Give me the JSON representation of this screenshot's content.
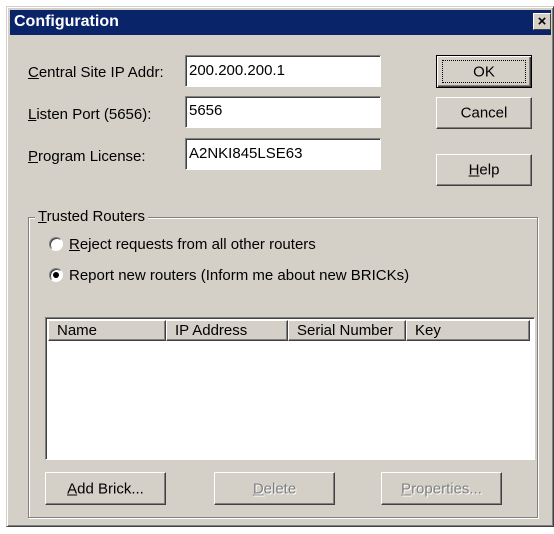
{
  "window": {
    "title": "Configuration",
    "close_glyph": "×"
  },
  "form": {
    "central_ip": {
      "label_accel": "C",
      "label_rest": "entral Site IP Addr:",
      "value": "200.200.200.1"
    },
    "listen_port": {
      "label_accel": "L",
      "label_rest": "isten Port (5656):",
      "value": "5656"
    },
    "license": {
      "label_accel": "P",
      "label_rest": "rogram License:",
      "value": "A2NKI845LSE63"
    }
  },
  "buttons": {
    "ok": "OK",
    "cancel": "Cancel",
    "help_accel": "H",
    "help_rest": "elp"
  },
  "trusted": {
    "legend_accel": "T",
    "legend_rest": "rusted Routers",
    "radio_reject_accel": "R",
    "radio_reject_rest": "eject requests from all other routers",
    "radio_report_text": "Report new routers  (Inform me about new BRICKs)",
    "selected_option": "report"
  },
  "table": {
    "columns": [
      "Name",
      "IP Address",
      "Serial Number",
      "Key"
    ],
    "rows": []
  },
  "bottom_buttons": {
    "add_accel": "A",
    "add_rest": "dd Brick...",
    "delete_accel": "D",
    "delete_rest": "elete",
    "properties_accel": "P",
    "properties_rest": "roperties..."
  },
  "colors": {
    "title_bar": "#0a246a",
    "face": "#d4d0c8"
  }
}
